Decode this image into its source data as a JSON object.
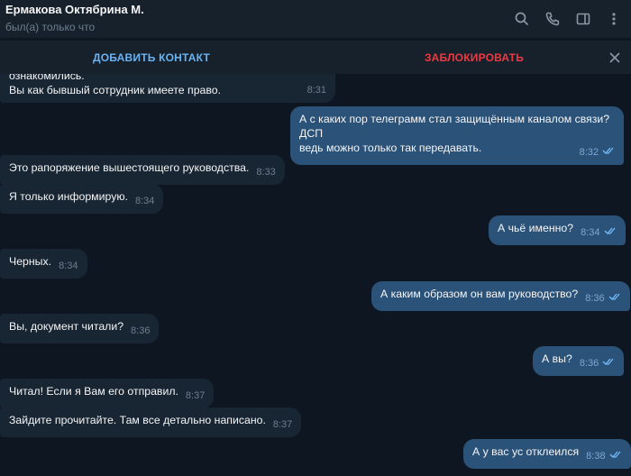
{
  "header": {
    "name": "Ермакова Октябрина М.",
    "status": "был(а) только что",
    "icons": [
      "search-icon",
      "phone-icon",
      "sidebar-icon",
      "more-icon"
    ]
  },
  "actions": {
    "add_contact": "ДОБАВИТЬ КОНТАКТ",
    "block": "ЗАБЛОКИРОВАТЬ"
  },
  "messages": [
    {
      "dir": "in",
      "lines": [
        "ознакомились.",
        "Вы как бывшый сотрудник имеете право."
      ],
      "time": "8:31"
    },
    {
      "dir": "out",
      "lines": [
        "А с каких пор телеграмм стал защищённым каналом связи? ДСП",
        "ведь можно только так передавать."
      ],
      "time": "8:32"
    },
    {
      "dir": "in",
      "text": "Это рапоряжение вышестоящего руководства.",
      "time": "8:33"
    },
    {
      "dir": "in",
      "text": "Я только информирую.",
      "time": "8:34"
    },
    {
      "dir": "out",
      "text": "А чьё именно?",
      "time": "8:34"
    },
    {
      "dir": "in",
      "text": "Черных.",
      "time": "8:34"
    },
    {
      "dir": "out",
      "text": "А каким образом он вам руководство?",
      "time": "8:36"
    },
    {
      "dir": "in",
      "text": "Вы, документ читали?",
      "time": "8:36"
    },
    {
      "dir": "out",
      "text": "А вы?",
      "time": "8:36"
    },
    {
      "dir": "in",
      "text": "Читал! Если я Вам его отправил.",
      "time": "8:37"
    },
    {
      "dir": "in",
      "text": "Зайдите прочитайте. Там все детально написано.",
      "time": "8:37"
    },
    {
      "dir": "out",
      "text": "А у вас ус отклеился",
      "time": "8:38"
    }
  ],
  "colors": {
    "background": "#0e1621",
    "header": "#17212b",
    "incoming": "#182533",
    "outgoing": "#2b5278",
    "link": "#6ab3f3",
    "danger": "#ec3942"
  }
}
